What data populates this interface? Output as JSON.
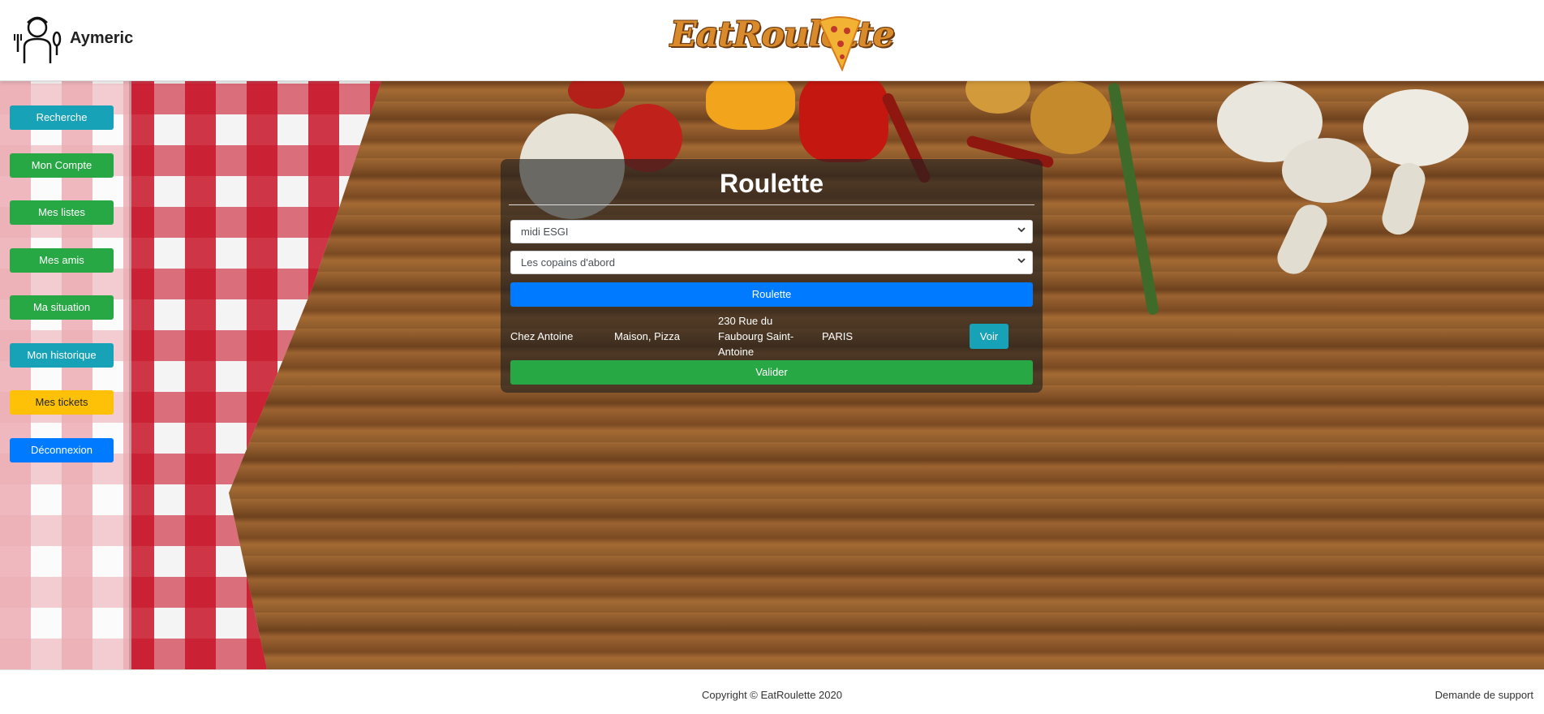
{
  "header": {
    "username": "Aymeric",
    "logo_text": "EatRoulette"
  },
  "sidebar": {
    "items": [
      {
        "label": "Recherche",
        "color": "#17a2b8"
      },
      {
        "label": "Mon Compte",
        "color": "#28a745"
      },
      {
        "label": "Mes listes",
        "color": "#28a745"
      },
      {
        "label": "Mes amis",
        "color": "#28a745"
      },
      {
        "label": "Ma situation",
        "color": "#28a745"
      },
      {
        "label": "Mon historique",
        "color": "#17a2b8"
      },
      {
        "label": "Mes tickets",
        "color": "#ffc107"
      },
      {
        "label": "Déconnexion",
        "color": "#007bff"
      }
    ]
  },
  "roulette": {
    "title": "Roulette",
    "list_select": "midi ESGI",
    "group_select": "Les copains d'abord",
    "spin_label": "Roulette",
    "result": {
      "name": "Chez Antoine",
      "type": "Maison, Pizza",
      "address": "230 Rue du Faubourg Saint-Antoine",
      "city": "PARIS",
      "view_label": "Voir"
    },
    "validate_label": "Valider"
  },
  "footer": {
    "copyright": "Copyright © EatRoulette 2020",
    "support": "Demande de support"
  },
  "colors": {
    "info": "#17a2b8",
    "success": "#28a745",
    "warning": "#ffc107",
    "primary": "#007bff"
  }
}
